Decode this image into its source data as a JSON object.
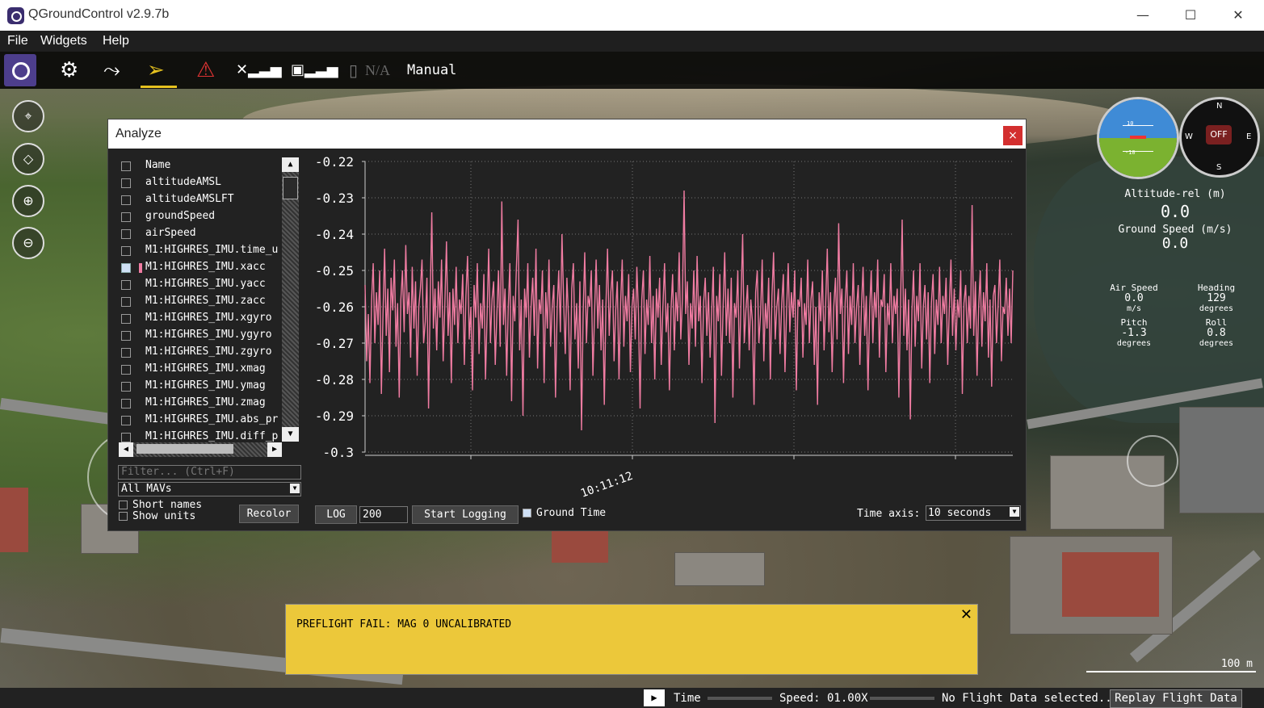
{
  "window": {
    "title": "QGroundControl v2.9.7b",
    "minimize": "—",
    "maximize": "☐",
    "close": "✕"
  },
  "menu": [
    "File",
    "Widgets",
    "Help"
  ],
  "toolbar": {
    "battery": "N/A",
    "flight_mode": "Manual"
  },
  "hud": {
    "altitude_label": "Altitude-rel (m)",
    "altitude_value": "0.0",
    "ground_speed_label": "Ground Speed (m/s)",
    "ground_speed_value": "0.0",
    "air_speed_label": "Air Speed",
    "air_speed_value": "0.0",
    "air_speed_unit": "m/s",
    "heading_label": "Heading",
    "heading_value": "129",
    "heading_unit": "degrees",
    "pitch_label": "Pitch",
    "pitch_value": "-1.3",
    "pitch_unit": "degrees",
    "roll_label": "Roll",
    "roll_value": "0.8",
    "roll_unit": "degrees",
    "compass_n": "N",
    "compass_s": "S",
    "compass_e": "E",
    "compass_w": "W",
    "compass_off": "OFF",
    "att_tick_top": "10",
    "att_tick_bottom": "-10"
  },
  "analyze": {
    "title": "Analyze",
    "close": "×",
    "list": [
      {
        "name": "Name",
        "checked": false,
        "swatch": false
      },
      {
        "name": "altitudeAMSL",
        "checked": false,
        "swatch": false
      },
      {
        "name": "altitudeAMSLFT",
        "checked": false,
        "swatch": false
      },
      {
        "name": "groundSpeed",
        "checked": false,
        "swatch": false
      },
      {
        "name": "airSpeed",
        "checked": false,
        "swatch": false
      },
      {
        "name": "M1:HIGHRES_IMU.time_u",
        "checked": false,
        "swatch": false
      },
      {
        "name": "M1:HIGHRES_IMU.xacc",
        "checked": true,
        "swatch": true
      },
      {
        "name": "M1:HIGHRES_IMU.yacc",
        "checked": false,
        "swatch": false
      },
      {
        "name": "M1:HIGHRES_IMU.zacc",
        "checked": false,
        "swatch": false
      },
      {
        "name": "M1:HIGHRES_IMU.xgyro",
        "checked": false,
        "swatch": false
      },
      {
        "name": "M1:HIGHRES_IMU.ygyro",
        "checked": false,
        "swatch": false
      },
      {
        "name": "M1:HIGHRES_IMU.zgyro",
        "checked": false,
        "swatch": false
      },
      {
        "name": "M1:HIGHRES_IMU.xmag",
        "checked": false,
        "swatch": false
      },
      {
        "name": "M1:HIGHRES_IMU.ymag",
        "checked": false,
        "swatch": false
      },
      {
        "name": "M1:HIGHRES_IMU.zmag",
        "checked": false,
        "swatch": false
      },
      {
        "name": "M1:HIGHRES_IMU.abs_pr",
        "checked": false,
        "swatch": false
      },
      {
        "name": "M1:HIGHRES_IMU.diff_p",
        "checked": false,
        "swatch": false
      }
    ],
    "filter_placeholder": "Filter... (Ctrl+F)",
    "mav_select": "All MAVs",
    "short_names": "Short names",
    "show_units": "Show units",
    "recolor": "Recolor",
    "log": "LOG",
    "points": "200",
    "start_logging": "Start Logging",
    "ground_time": "Ground Time",
    "time_axis_label": "Time axis:",
    "time_axis_value": "10 seconds"
  },
  "chart_data": {
    "type": "line",
    "series_color": "#f07ca2",
    "ylim": [
      -0.3,
      -0.22
    ],
    "y_ticks": [
      "-0.22",
      "-0.23",
      "-0.24",
      "-0.25",
      "-0.26",
      "-0.27",
      "-0.28",
      "-0.29",
      "-0.3"
    ],
    "x_tick_label": "10:11:12",
    "grid": true,
    "values": [
      -0.254,
      -0.275,
      -0.262,
      -0.281,
      -0.258,
      -0.248,
      -0.27,
      -0.256,
      -0.265,
      -0.25,
      -0.284,
      -0.262,
      -0.244,
      -0.268,
      -0.255,
      -0.278,
      -0.252,
      -0.261,
      -0.247,
      -0.271,
      -0.259,
      -0.285,
      -0.258,
      -0.25,
      -0.267,
      -0.243,
      -0.262,
      -0.256,
      -0.274,
      -0.249,
      -0.266,
      -0.253,
      -0.279,
      -0.26,
      -0.255,
      -0.247,
      -0.27,
      -0.264,
      -0.252,
      -0.288,
      -0.258,
      -0.234,
      -0.266,
      -0.255,
      -0.272,
      -0.253,
      -0.263,
      -0.247,
      -0.275,
      -0.26,
      -0.242,
      -0.268,
      -0.256,
      -0.281,
      -0.255,
      -0.265,
      -0.249,
      -0.27,
      -0.258,
      -0.262,
      -0.251,
      -0.276,
      -0.257,
      -0.246,
      -0.269,
      -0.26,
      -0.283,
      -0.254,
      -0.263,
      -0.248,
      -0.273,
      -0.259,
      -0.266,
      -0.251,
      -0.28,
      -0.262,
      -0.244,
      -0.27,
      -0.258,
      -0.253,
      -0.276,
      -0.262,
      -0.25,
      -0.271,
      -0.231,
      -0.265,
      -0.255,
      -0.279,
      -0.26,
      -0.248,
      -0.286,
      -0.257,
      -0.264,
      -0.249,
      -0.236,
      -0.272,
      -0.258,
      -0.29,
      -0.255,
      -0.263,
      -0.248,
      -0.274,
      -0.26,
      -0.252,
      -0.268,
      -0.244,
      -0.277,
      -0.258,
      -0.262,
      -0.25,
      -0.281,
      -0.256,
      -0.266,
      -0.247,
      -0.271,
      -0.26,
      -0.254,
      -0.285,
      -0.261,
      -0.25,
      -0.267,
      -0.24,
      -0.258,
      -0.273,
      -0.252,
      -0.263,
      -0.283,
      -0.255,
      -0.248,
      -0.269,
      -0.259,
      -0.277,
      -0.253,
      -0.294,
      -0.262,
      -0.245,
      -0.27,
      -0.257,
      -0.26,
      -0.25,
      -0.279,
      -0.262,
      -0.247,
      -0.266,
      -0.254,
      -0.272,
      -0.258,
      -0.287,
      -0.26,
      -0.244,
      -0.268,
      -0.256,
      -0.25,
      -0.275,
      -0.261,
      -0.253,
      -0.28,
      -0.259,
      -0.247,
      -0.271,
      -0.257,
      -0.264,
      -0.251,
      -0.278,
      -0.26,
      -0.255,
      -0.269,
      -0.249,
      -0.262,
      -0.288,
      -0.258,
      -0.25,
      -0.273,
      -0.258,
      -0.265,
      -0.246,
      -0.27,
      -0.257,
      -0.28,
      -0.255,
      -0.263,
      -0.252,
      -0.276,
      -0.26,
      -0.248,
      -0.267,
      -0.259,
      -0.283,
      -0.261,
      -0.251,
      -0.272,
      -0.256,
      -0.264,
      -0.245,
      -0.269,
      -0.258,
      -0.228,
      -0.262,
      -0.253,
      -0.276,
      -0.259,
      -0.266,
      -0.25,
      -0.271,
      -0.246,
      -0.264,
      -0.257,
      -0.281,
      -0.259,
      -0.252,
      -0.268,
      -0.256,
      -0.274,
      -0.261,
      -0.249,
      -0.292,
      -0.257,
      -0.264,
      -0.251,
      -0.279,
      -0.26,
      -0.245,
      -0.268,
      -0.255,
      -0.27,
      -0.252,
      -0.285,
      -0.259,
      -0.263,
      -0.25,
      -0.277,
      -0.258,
      -0.24,
      -0.27,
      -0.261,
      -0.254,
      -0.272,
      -0.258,
      -0.264,
      -0.287,
      -0.256,
      -0.25,
      -0.27,
      -0.262,
      -0.247,
      -0.275,
      -0.259,
      -0.266,
      -0.252,
      -0.28,
      -0.257,
      -0.245,
      -0.269,
      -0.26,
      -0.255,
      -0.273,
      -0.259,
      -0.251,
      -0.278,
      -0.261,
      -0.248,
      -0.267,
      -0.256,
      -0.263,
      -0.25,
      -0.283,
      -0.258,
      -0.26,
      -0.252,
      -0.274,
      -0.259,
      -0.265,
      -0.247,
      -0.27,
      -0.258,
      -0.253,
      -0.276,
      -0.26,
      -0.287,
      -0.256,
      -0.264,
      -0.25,
      -0.272,
      -0.259,
      -0.244,
      -0.267,
      -0.256,
      -0.278,
      -0.26,
      -0.252,
      -0.269,
      -0.237,
      -0.262,
      -0.255,
      -0.281,
      -0.259,
      -0.25,
      -0.273,
      -0.257,
      -0.265,
      -0.248,
      -0.27,
      -0.26,
      -0.254,
      -0.276,
      -0.26,
      -0.249,
      -0.268,
      -0.257,
      -0.283,
      -0.261,
      -0.25,
      -0.27,
      -0.256,
      -0.263,
      -0.247,
      -0.274,
      -0.258,
      -0.26,
      -0.251,
      -0.278,
      -0.259,
      -0.265,
      -0.248,
      -0.27,
      -0.257,
      -0.262,
      -0.255,
      -0.285,
      -0.259,
      -0.236,
      -0.268,
      -0.255,
      -0.272,
      -0.258,
      -0.291,
      -0.261,
      -0.25,
      -0.271,
      -0.257,
      -0.264,
      -0.248,
      -0.277,
      -0.26,
      -0.254,
      -0.269,
      -0.256,
      -0.281,
      -0.259,
      -0.251,
      -0.273,
      -0.258,
      -0.265,
      -0.249,
      -0.27,
      -0.257,
      -0.262,
      -0.252,
      -0.276,
      -0.26,
      -0.247,
      -0.268,
      -0.255,
      -0.272,
      -0.258,
      -0.263,
      -0.25,
      -0.284,
      -0.259,
      -0.254,
      -0.27,
      -0.257,
      -0.266,
      -0.232,
      -0.268,
      -0.253,
      -0.279,
      -0.26,
      -0.25,
      -0.271,
      -0.256,
      -0.264,
      -0.248,
      -0.274,
      -0.258,
      -0.282,
      -0.257,
      -0.254,
      -0.27,
      -0.259,
      -0.247,
      -0.275,
      -0.26,
      -0.262,
      -0.252,
      -0.268,
      -0.255,
      -0.27,
      -0.25
    ]
  },
  "toast": {
    "message": "PREFLIGHT FAIL: MAG 0 UNCALIBRATED",
    "close": "✕"
  },
  "bottombar": {
    "time": "Time",
    "speed": "Speed: 01.00X",
    "status": "No Flight Data selected..",
    "replay": "Replay Flight Data"
  },
  "map": {
    "scale": "100 m"
  }
}
